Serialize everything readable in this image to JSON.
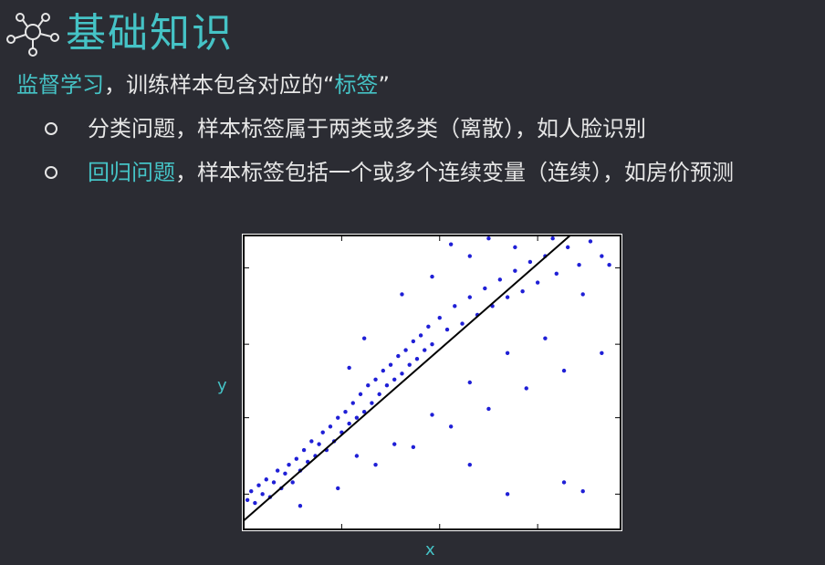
{
  "header": {
    "title": "基础知识",
    "icon": "network-hub-icon"
  },
  "intro": {
    "term": "监督学习",
    "text_before_label": "，训练样本包含对应的“",
    "label_word": "标签",
    "text_after_label": "”"
  },
  "bullets": [
    {
      "accent": "",
      "text": "分类问题，样本标签属于两类或多类（离散），如人脸识别"
    },
    {
      "accent": "回归问题",
      "text": "，样本标签包括一个或多个连续变量（连续），如房价预测"
    }
  ],
  "chart_data": {
    "type": "scatter",
    "xlabel": "x",
    "ylabel": "y",
    "xlim": [
      0,
      10
    ],
    "ylim": [
      0,
      10
    ],
    "grid": false,
    "point_color": "#1f1fd6",
    "line_color": "#000000",
    "fit_line": {
      "x": [
        0,
        10
      ],
      "y": [
        0.3,
        11.5
      ]
    },
    "x_ticks": [
      2.6,
      5.2,
      7.8
    ],
    "y_ticks": [
      1.2,
      3.8,
      6.3,
      8.9
    ],
    "scatter_points": [
      [
        0.1,
        1.0
      ],
      [
        0.2,
        1.3
      ],
      [
        0.3,
        0.9
      ],
      [
        0.4,
        1.5
      ],
      [
        0.5,
        1.2
      ],
      [
        0.6,
        1.7
      ],
      [
        0.7,
        1.1
      ],
      [
        0.8,
        1.6
      ],
      [
        0.9,
        2.0
      ],
      [
        1.0,
        1.4
      ],
      [
        1.1,
        1.9
      ],
      [
        1.2,
        2.2
      ],
      [
        1.3,
        1.6
      ],
      [
        1.4,
        2.4
      ],
      [
        1.5,
        2.0
      ],
      [
        1.6,
        2.7
      ],
      [
        1.7,
        2.3
      ],
      [
        1.8,
        3.0
      ],
      [
        1.9,
        2.5
      ],
      [
        2.0,
        2.9
      ],
      [
        2.1,
        3.3
      ],
      [
        2.2,
        2.7
      ],
      [
        2.3,
        3.5
      ],
      [
        2.4,
        3.0
      ],
      [
        2.5,
        3.8
      ],
      [
        2.6,
        3.3
      ],
      [
        2.7,
        4.0
      ],
      [
        2.8,
        3.6
      ],
      [
        2.9,
        4.3
      ],
      [
        3.0,
        3.8
      ],
      [
        3.1,
        4.6
      ],
      [
        3.2,
        4.0
      ],
      [
        3.3,
        4.9
      ],
      [
        3.4,
        4.3
      ],
      [
        3.5,
        5.1
      ],
      [
        3.6,
        4.6
      ],
      [
        3.7,
        5.4
      ],
      [
        3.8,
        4.9
      ],
      [
        3.9,
        5.6
      ],
      [
        4.0,
        5.1
      ],
      [
        4.1,
        5.9
      ],
      [
        4.2,
        5.3
      ],
      [
        4.3,
        6.1
      ],
      [
        4.4,
        5.6
      ],
      [
        4.5,
        6.4
      ],
      [
        4.6,
        5.8
      ],
      [
        4.7,
        6.6
      ],
      [
        4.8,
        6.1
      ],
      [
        4.9,
        6.9
      ],
      [
        5.0,
        6.3
      ],
      [
        5.2,
        7.2
      ],
      [
        5.4,
        6.8
      ],
      [
        5.6,
        7.6
      ],
      [
        5.8,
        7.0
      ],
      [
        6.0,
        7.9
      ],
      [
        6.2,
        7.3
      ],
      [
        6.4,
        8.2
      ],
      [
        6.6,
        7.6
      ],
      [
        6.8,
        8.5
      ],
      [
        7.0,
        7.9
      ],
      [
        7.2,
        8.8
      ],
      [
        7.4,
        8.1
      ],
      [
        7.6,
        9.1
      ],
      [
        7.8,
        8.4
      ],
      [
        8.0,
        9.3
      ],
      [
        8.3,
        8.7
      ],
      [
        8.6,
        9.6
      ],
      [
        8.9,
        9.0
      ],
      [
        9.2,
        9.8
      ],
      [
        9.5,
        9.3
      ],
      [
        1.5,
        0.8
      ],
      [
        2.5,
        1.4
      ],
      [
        3.5,
        2.2
      ],
      [
        4.5,
        2.8
      ],
      [
        5.5,
        3.5
      ],
      [
        6.5,
        4.1
      ],
      [
        7.5,
        4.8
      ],
      [
        8.5,
        5.4
      ],
      [
        9.5,
        6.0
      ],
      [
        6.0,
        2.2
      ],
      [
        7.0,
        1.2
      ],
      [
        8.5,
        1.6
      ],
      [
        9.0,
        1.3
      ],
      [
        5.0,
        3.9
      ],
      [
        6.0,
        5.0
      ],
      [
        4.0,
        2.9
      ],
      [
        3.0,
        2.5
      ],
      [
        7.0,
        6.0
      ],
      [
        8.0,
        6.5
      ],
      [
        9.0,
        8.0
      ],
      [
        4.2,
        8.0
      ],
      [
        5.0,
        8.6
      ],
      [
        6.0,
        9.3
      ],
      [
        5.5,
        9.7
      ],
      [
        3.2,
        6.5
      ],
      [
        2.8,
        5.5
      ],
      [
        6.5,
        9.9
      ],
      [
        7.2,
        9.6
      ],
      [
        8.2,
        9.9
      ],
      [
        9.7,
        9.0
      ]
    ]
  }
}
